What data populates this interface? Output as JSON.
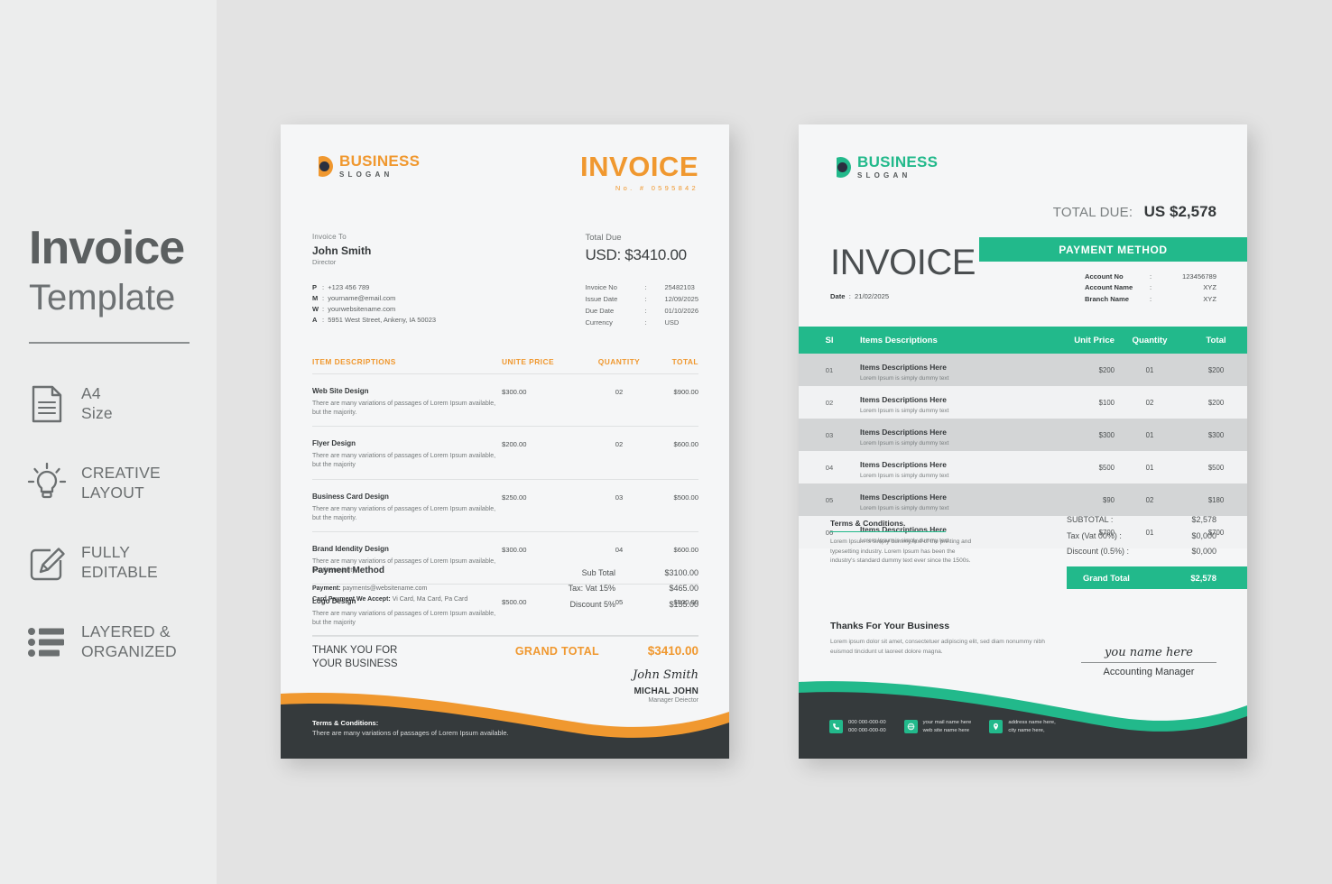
{
  "promo": {
    "title": "Invoice",
    "subtitle": "Template",
    "features": [
      {
        "icon": "document-icon",
        "line1": "A4",
        "line2": "Size",
        "caps": false
      },
      {
        "icon": "lightbulb-icon",
        "line1": "CREATIVE",
        "line2": "LAYOUT",
        "caps": true
      },
      {
        "icon": "pencil-edit-icon",
        "line1": "FULLY",
        "line2": "EDITABLE",
        "caps": true
      },
      {
        "icon": "list-icon",
        "line1": "LAYERED &",
        "line2": "ORGANIZED",
        "caps": true
      }
    ]
  },
  "colors": {
    "orange": "#f0982f",
    "teal": "#22b98b",
    "dark": "#353a3c",
    "panel_bg": "#eceded",
    "page_bg": "#e3e3e3",
    "sheet_bg": "#f5f6f7"
  },
  "invoice_a": {
    "logo": {
      "name": "BUSINESS",
      "slogan": "SLOGAN"
    },
    "title": "INVOICE",
    "number": "No.  #  0595842",
    "bill_to_label": "Invoice To",
    "client_name": "John Smith",
    "client_role": "Director",
    "contact": [
      {
        "key": "P",
        "value": "+123 456 789"
      },
      {
        "key": "M",
        "value": "yourname@email.com"
      },
      {
        "key": "W",
        "value": "yourwebsitename.com"
      },
      {
        "key": "A",
        "value": "5951 West Street, Ankeny, IA 50023"
      }
    ],
    "total_due_label": "Total Due",
    "total_due_value": "USD: $3410.00",
    "meta": [
      {
        "key": "Invoice No",
        "value": "25482103"
      },
      {
        "key": "Issue Date",
        "value": "12/09/2025"
      },
      {
        "key": "Due Date",
        "value": "01/10/2026"
      },
      {
        "key": "Currency",
        "value": "USD"
      }
    ],
    "columns": [
      "ITEM DESCRIPTIONS",
      "UNITE PRICE",
      "QUANTITY",
      "TOTAL"
    ],
    "items": [
      {
        "title": "Web Site Design",
        "desc": "There are many variations of passages of Lorem Ipsum available, but the majority.",
        "price": "$300.00",
        "qty": "02",
        "total": "$900.00"
      },
      {
        "title": "Flyer Design",
        "desc": "There are many variations of passages of Lorem Ipsum available, but the majority",
        "price": "$200.00",
        "qty": "02",
        "total": "$600.00"
      },
      {
        "title": "Business Card Design",
        "desc": "There are many variations of passages of Lorem Ipsum available, but the majority.",
        "price": "$250.00",
        "qty": "03",
        "total": "$500.00"
      },
      {
        "title": "Brand Idendity Design",
        "desc": "There are many variations of passages of Lorem Ipsum available, but the majority",
        "price": "$300.00",
        "qty": "04",
        "total": "$600.00"
      },
      {
        "title": "Logo Design",
        "desc": "There are many variations of passages of Lorem Ipsum available, but the majority",
        "price": "$500.00",
        "qty": "05",
        "total": "$500.00"
      }
    ],
    "payment_title": "Payment Method",
    "payment_line1_k": "Payment:",
    "payment_line1_v": "payments@websitename.com",
    "payment_line2_k": "Card Payment We Accept:",
    "payment_line2_v": "Vi Card, Ma Card, Pa Card",
    "totals": [
      {
        "key": "Sub Total",
        "value": "$3100.00"
      },
      {
        "key": "Tax: Vat 15%",
        "value": "$465.00"
      },
      {
        "key": "Discount 5%",
        "value": "$155.00"
      }
    ],
    "grand_label": "GRAND TOTAL",
    "grand_value": "$3410.00",
    "thanks_line1": "THANK YOU FOR",
    "thanks_line2": "YOUR BUSINESS",
    "signature_script": "John Smith",
    "signature_name": "MICHAL JOHN",
    "signature_role": "Manager Deiector",
    "terms_title": "Terms & Conditions:",
    "terms_text": "There are many variations of passages of Lorem Ipsum available."
  },
  "invoice_b": {
    "logo": {
      "name": "BUSINESS",
      "slogan": "SLOGAN"
    },
    "total_due_label": "TOTAL DUE:",
    "total_due_value": "US $2,578",
    "payment_method_label": "PAYMENT METHOD",
    "account": [
      {
        "key": "Account No",
        "value": "123456789"
      },
      {
        "key": "Account Name",
        "value": "XYZ"
      },
      {
        "key": "Branch Name",
        "value": "XYZ"
      }
    ],
    "title": "INVOICE",
    "date_label": "Date",
    "date_value": "21/02/2025",
    "columns": [
      "Sl",
      "Items Descriptions",
      "Unit Price",
      "Quantity",
      "Total"
    ],
    "items": [
      {
        "sl": "01",
        "title": "Items Descriptions Here",
        "desc": "Lorem Ipsum is simply dummy text",
        "price": "$200",
        "qty": "01",
        "total": "$200"
      },
      {
        "sl": "02",
        "title": "Items Descriptions Here",
        "desc": "Lorem Ipsum is simply dummy text",
        "price": "$100",
        "qty": "02",
        "total": "$200"
      },
      {
        "sl": "03",
        "title": "Items Descriptions Here",
        "desc": "Lorem Ipsum is simply dummy text",
        "price": "$300",
        "qty": "01",
        "total": "$300"
      },
      {
        "sl": "04",
        "title": "Items Descriptions Here",
        "desc": "Lorem Ipsum is simply dummy text",
        "price": "$500",
        "qty": "01",
        "total": "$500"
      },
      {
        "sl": "05",
        "title": "Items Descriptions Here",
        "desc": "Lorem Ipsum is simply dummy text",
        "price": "$90",
        "qty": "02",
        "total": "$180"
      },
      {
        "sl": "06",
        "title": "Items Descriptions Here",
        "desc": "Lorem Ipsum is simply dummy text",
        "price": "$700",
        "qty": "01",
        "total": "$700"
      }
    ],
    "terms_title": "Terms & Conditions.",
    "terms_text": "Lorem Ipsum is simply dummy text of the printing and typesetting industry. Lorem Ipsum has been the industry's standard dummy text ever since the 1500s.",
    "totals": [
      {
        "key": "SUBTOTAL :",
        "value": "$2,578"
      },
      {
        "key": "Tax (Vat 00%) :",
        "value": "$0,000"
      },
      {
        "key": "Discount (0.5%) :",
        "value": "$0,000"
      }
    ],
    "grand_label": "Grand Total",
    "grand_value": "$2,578",
    "thanks_title": "Thanks For Your Business",
    "thanks_text": "Lorem ipsum dolor sit amet, consectetuer adipiscing elit, sed diam nonummy nibh euismod tincidunt ut laoreet dolore magna.",
    "signature_script": "you name here",
    "signature_role": "Accounting Manager",
    "footer_contacts": [
      {
        "icon": "phone-icon",
        "line1": "000 000-000-00",
        "line2": "000 000-000-00"
      },
      {
        "icon": "globe-icon",
        "line1": "your mail name here",
        "line2": "web site name here"
      },
      {
        "icon": "location-pin-icon",
        "line1": "address name here,",
        "line2": "city name here,"
      }
    ]
  }
}
